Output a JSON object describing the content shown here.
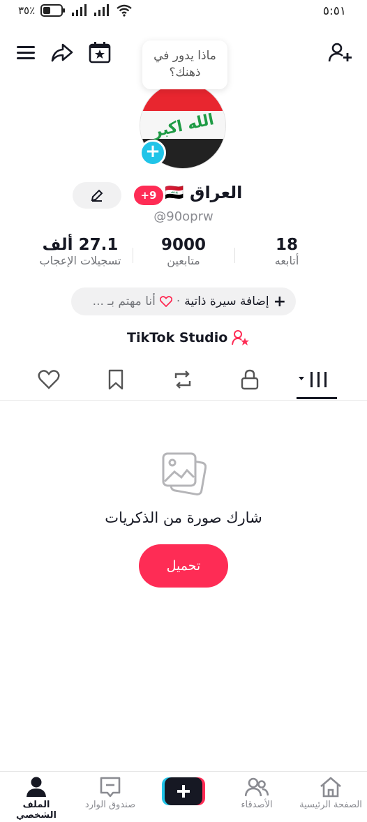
{
  "status_bar": {
    "time": "٥:٥١",
    "battery": "٪٣٥"
  },
  "tooltip": {
    "line1": "ماذا يدور في",
    "line2": "ذهنك؟"
  },
  "profile": {
    "name": "العراق",
    "flag": "🇮🇶",
    "badge": "+9",
    "handle": "@90oprw"
  },
  "stats": [
    {
      "value": "18",
      "label": "أتابعه"
    },
    {
      "value": "9000",
      "label": "متابعين"
    },
    {
      "value": "27.1 ألف",
      "label": "تسجيلات الإعجاب"
    }
  ],
  "bio": {
    "add_label": "إضافة سيرة ذاتية",
    "separator": "·",
    "interest_label": "أنا مهتم بـ ..."
  },
  "studio_label": "TikTok Studio",
  "tabs": [
    {
      "icon": "grid-icon",
      "active": true
    },
    {
      "icon": "lock-icon",
      "active": false
    },
    {
      "icon": "repost-icon",
      "active": false
    },
    {
      "icon": "bookmark-icon",
      "active": false
    },
    {
      "icon": "heart-icon",
      "active": false
    }
  ],
  "empty_state": {
    "title": "شارك صورة من الذكريات",
    "button": "تحميل"
  },
  "bottom_nav": [
    {
      "label": "الصفحة الرئيسية",
      "icon": "home-icon"
    },
    {
      "label": "الأصدقاء",
      "icon": "friends-icon"
    },
    {
      "label": "",
      "icon": "create-icon"
    },
    {
      "label": "صندوق الوارد",
      "icon": "inbox-icon"
    },
    {
      "label": "الملف الشخصي",
      "icon": "profile-icon",
      "active": true
    }
  ],
  "colors": {
    "accent": "#fe2c55",
    "cyan": "#20c4e8",
    "text": "#161823",
    "muted": "#8a8b91"
  }
}
